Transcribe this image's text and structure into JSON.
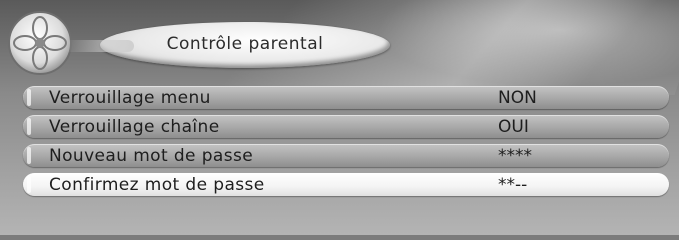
{
  "header": {
    "title": "Contrôle parental",
    "logo_icon": "flower-logo-icon"
  },
  "menu": {
    "items": [
      {
        "label": "Verrouillage menu",
        "value": "NON",
        "selected": false
      },
      {
        "label": "Verrouillage chaîne",
        "value": "OUI",
        "selected": false
      },
      {
        "label": "Nouveau mot de passe",
        "value": "****",
        "selected": false
      },
      {
        "label": "Confirmez mot de passe",
        "value": "**--",
        "selected": true
      }
    ]
  },
  "colors": {
    "row_bar": "#a7a7a7",
    "row_selected": "#f4f4f4",
    "text": "#1e1e1e"
  }
}
